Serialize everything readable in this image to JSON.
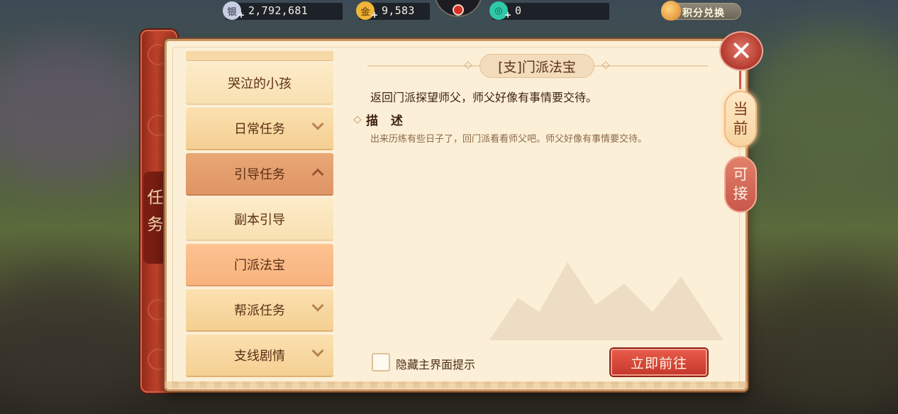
{
  "currencies": [
    {
      "name": "silver",
      "value": "2,792,681",
      "icon": "silver-coin-icon",
      "color": "#c9cfe3"
    },
    {
      "name": "gold",
      "value": "9,583",
      "icon": "gold-coin-icon",
      "color": "#f1b53a"
    },
    {
      "name": "jade",
      "value": "0",
      "icon": "jade-icon",
      "color": "#2fc9a7"
    }
  ],
  "exchange": {
    "label": "积分兑换"
  },
  "panel": {
    "scroll_title_1": "任",
    "scroll_title_2": "务"
  },
  "task_list": {
    "items": [
      {
        "label": "哭泣的小孩",
        "kind": "sub"
      },
      {
        "label": "日常任务",
        "kind": "category",
        "state": "collapsed"
      },
      {
        "label": "引导任务",
        "kind": "category",
        "state": "expanded"
      },
      {
        "label": "副本引导",
        "kind": "sub"
      },
      {
        "label": "门派法宝",
        "kind": "sub",
        "state": "selected"
      },
      {
        "label": "帮派任务",
        "kind": "category",
        "state": "collapsed"
      },
      {
        "label": "支线剧情",
        "kind": "category",
        "state": "collapsed"
      }
    ]
  },
  "detail": {
    "title": "[支]门派法宝",
    "summary": "返回门派探望师父，师父好像有事情要交待。",
    "desc_heading": "描 述",
    "desc_text": "出来历练有些日子了，回门派看看师父吧。师父好像有事情要交待。"
  },
  "footer": {
    "hide_hint_label": "隐藏主界面提示",
    "go_button": "立即前往"
  },
  "side_tabs": [
    {
      "line1": "当",
      "line2": "前",
      "active": true
    },
    {
      "line1": "可",
      "line2": "接",
      "active": false
    }
  ],
  "close": {
    "glyph": "✕"
  },
  "colors": {
    "accent_red": "#c5392c",
    "panel_bg": "#fcefd7",
    "selected_item": "#f8b27e"
  }
}
